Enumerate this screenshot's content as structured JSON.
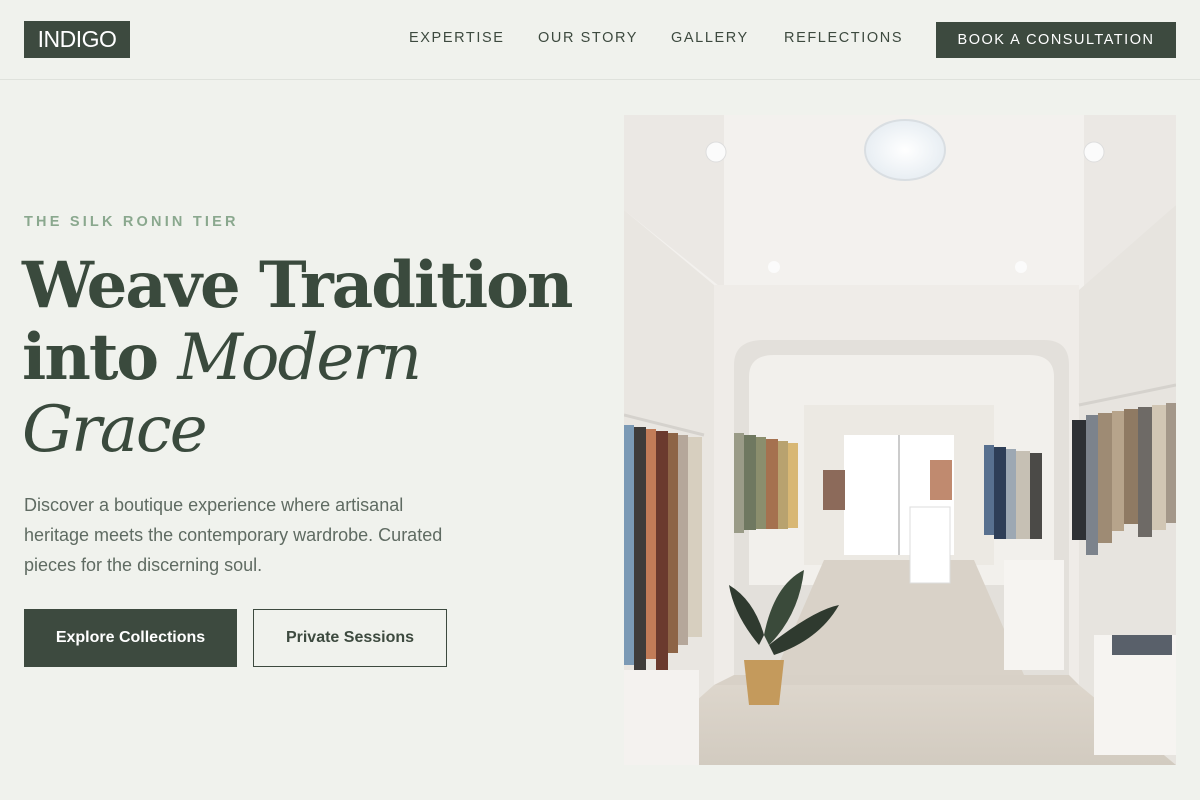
{
  "header": {
    "logo": "INDIGO",
    "nav": [
      {
        "label": "EXPERTISE"
      },
      {
        "label": "OUR STORY"
      },
      {
        "label": "GALLERY"
      },
      {
        "label": "REFLECTIONS"
      }
    ],
    "cta_label": "BOOK A CONSULTATION"
  },
  "hero": {
    "eyebrow": "THE SILK RONIN TIER",
    "headline_line1": "Weave Tradition",
    "headline_line2_plain": "into ",
    "headline_line2_italic": "Modern",
    "headline_line3_italic": "Grace",
    "description": "Discover a boutique experience where artisanal heritage meets the contemporary wardrobe. Curated pieces for the discerning soul.",
    "primary_button": "Explore Collections",
    "secondary_button": "Private Sessions"
  },
  "colors": {
    "background": "#f0f2ed",
    "brand_dark": "#3d4a3f",
    "accent_sage": "#8aa88e",
    "body_text": "#5f6b62"
  }
}
